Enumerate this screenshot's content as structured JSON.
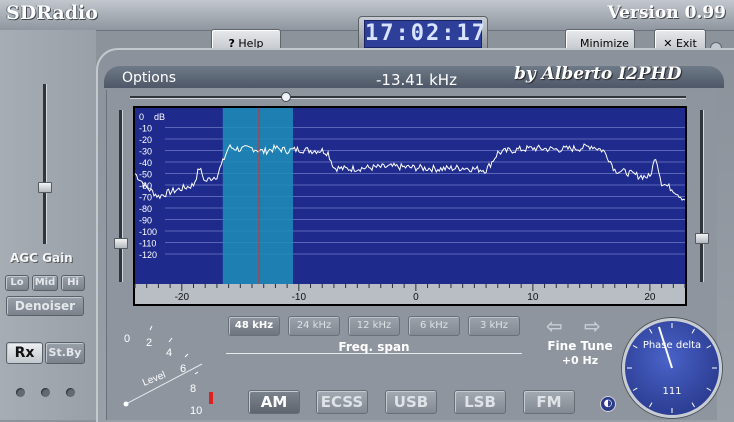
{
  "app": {
    "title": "SDRadio",
    "version": "Version 0.99",
    "author": "by Alberto I2PHD"
  },
  "clock": {
    "time": "17:02:17"
  },
  "buttons": {
    "help": "Help",
    "minimize": "Minimize",
    "exit": "Exit"
  },
  "header": {
    "options": "Options",
    "frequency": "-13.41 kHz"
  },
  "left": {
    "agc_gain": "AGC Gain",
    "agc_levels": [
      "Lo",
      "Mid",
      "Hi"
    ],
    "denoiser": "Denoiser",
    "rx": "Rx",
    "standby": "St.By"
  },
  "spectrum": {
    "db_unit": "dB",
    "y_ticks": [
      "0",
      "-10",
      "-20",
      "-30",
      "-40",
      "-50",
      "-60",
      "-70",
      "-80",
      "-90",
      "-100",
      "-110",
      "-120"
    ],
    "x_ticks": [
      "-20",
      "-10",
      "0",
      "10",
      "20"
    ]
  },
  "freq_span": {
    "label": "Freq. span",
    "options": [
      "48 kHz",
      "24 kHz",
      "12 kHz",
      "6 kHz",
      "3 kHz"
    ],
    "selected": "48 kHz"
  },
  "level_meter": {
    "label": "Level",
    "ticks": [
      "0",
      "2",
      "4",
      "6",
      "8",
      "10"
    ]
  },
  "modes": {
    "options": [
      "AM",
      "ECSS",
      "USB",
      "LSB",
      "FM"
    ],
    "selected": "AM"
  },
  "fine_tune": {
    "label": "Fine Tune",
    "value": "+0 Hz"
  },
  "phase": {
    "label": "Phase delta",
    "value": "111"
  },
  "colors": {
    "spectrum_bg": "#1e2a8c",
    "passband": "#1f8fb8",
    "tuning_line": "#d23030",
    "trace": "#ffffff"
  },
  "chart_data": {
    "type": "line",
    "ylabel": "dB",
    "xlim": [
      -24,
      23
    ],
    "ylim": [
      -120,
      0
    ],
    "passband": [
      -16.5,
      -10.5
    ],
    "tuned_frequency": -13.41,
    "series": [
      {
        "x": [
          -24,
          -23,
          -22,
          -21,
          -20,
          -19,
          -18.5,
          -18,
          -17.5,
          -17,
          -16.5,
          -16,
          -15,
          -14,
          -13,
          -12,
          -11,
          -10,
          -9,
          -8,
          -7.5,
          -7,
          -6,
          -4,
          -2,
          0,
          2,
          4,
          6,
          6.5,
          7,
          8,
          10,
          12,
          14,
          15,
          16,
          16.5,
          17,
          18,
          19,
          20,
          20.5,
          21,
          22,
          23
        ],
        "y": [
          -50,
          -62,
          -70,
          -66,
          -63,
          -60,
          -45,
          -57,
          -54,
          -52,
          -40,
          -27,
          -29,
          -28,
          -31,
          -28,
          -30,
          -29,
          -30,
          -30,
          -32,
          -45,
          -46,
          -45,
          -44,
          -45,
          -46,
          -45,
          -47,
          -40,
          -32,
          -30,
          -28,
          -29,
          -28,
          -26,
          -30,
          -37,
          -47,
          -49,
          -52,
          -53,
          -35,
          -58,
          -64,
          -73
        ]
      }
    ]
  }
}
